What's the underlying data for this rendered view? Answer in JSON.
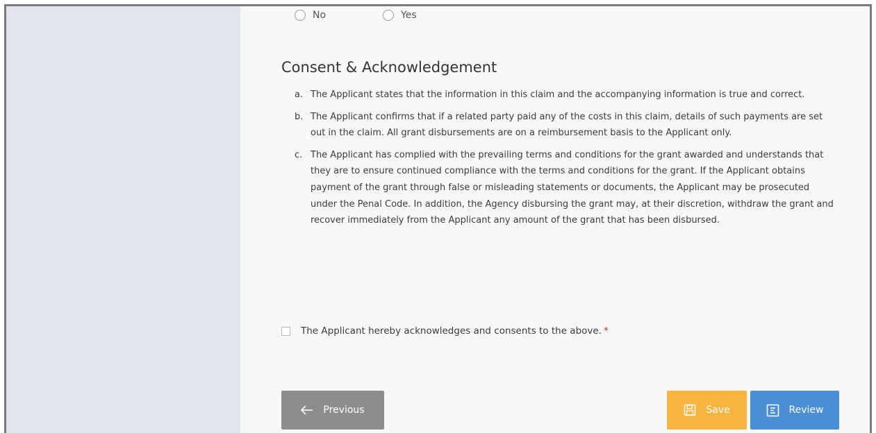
{
  "radio": {
    "options": [
      "No",
      "Yes"
    ]
  },
  "consent": {
    "title": "Consent & Acknowledgement",
    "items": [
      {
        "letter": "a.",
        "text": "The Applicant states that the information in this claim and the accompanying information is true and correct."
      },
      {
        "letter": "b.",
        "text": "The Applicant confirms that if a related party paid any of the costs in this claim, details of such payments are set out in the claim. All grant disbursements are on a reimbursement basis to the Applicant only."
      },
      {
        "letter": "c.",
        "text": "The Applicant has complied with the prevailing terms and conditions for the grant awarded and understands that they are to ensure continued compliance with the terms and conditions for the grant. If the Applicant obtains payment of the grant through false or misleading statements or documents, the Applicant may be prosecuted under the Penal Code. In addition, the Agency disbursing the grant may, at their discretion, withdraw the grant and recover immediately from the Applicant any amount of the grant that has been disbursed."
      }
    ],
    "acknowledge_label": "The Applicant hereby acknowledges and consents to the above.",
    "required_mark": "*"
  },
  "buttons": {
    "previous": "Previous",
    "save": "Save",
    "review": "Review"
  },
  "colors": {
    "sidebar": "#e0e6ec",
    "previous_button": "#8d8d8d",
    "save_button": "#f7b440",
    "review_button": "#4a8fd6",
    "required": "#d0202a"
  }
}
